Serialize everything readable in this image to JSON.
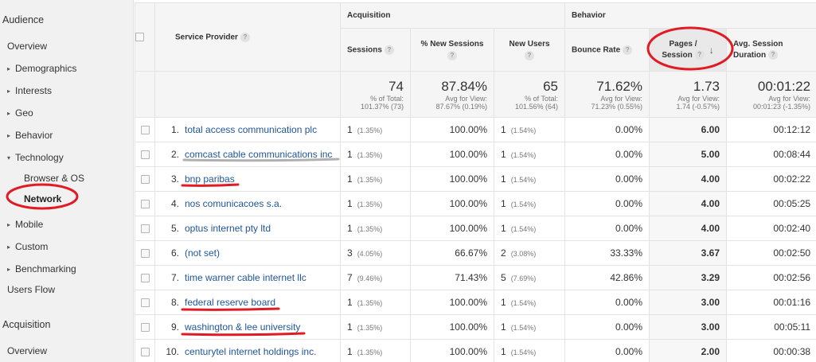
{
  "sidebar": {
    "audience": "Audience",
    "overview": "Overview",
    "demographics": "Demographics",
    "interests": "Interests",
    "geo": "Geo",
    "behavior": "Behavior",
    "technology": "Technology",
    "browser_os": "Browser & OS",
    "network": "Network",
    "mobile": "Mobile",
    "custom": "Custom",
    "benchmarking": "Benchmarking",
    "users_flow": "Users Flow",
    "acquisition": "Acquisition",
    "acq_overview": "Overview"
  },
  "table": {
    "dimension_header": "Service Provider",
    "group_acquisition": "Acquisition",
    "group_behavior": "Behavior",
    "col_sessions": "Sessions",
    "col_new_sessions": "% New Sessions",
    "col_new_users": "New Users",
    "col_bounce": "Bounce Rate",
    "col_pages_1": "Pages /",
    "col_pages_2": "Session",
    "col_duration_1": "Avg. Session",
    "col_duration_2": "Duration",
    "help_glyph": "?",
    "sort_glyph": "↓",
    "summary": {
      "sessions": "74",
      "sessions_sub1": "% of Total:",
      "sessions_sub2": "101.37% (73)",
      "new_sessions": "87.84%",
      "new_sessions_sub1": "Avg for View:",
      "new_sessions_sub2": "87.67% (0.19%)",
      "new_users": "65",
      "new_users_sub1": "% of Total:",
      "new_users_sub2": "101.56% (64)",
      "bounce": "71.62%",
      "bounce_sub1": "Avg for View:",
      "bounce_sub2": "71.23% (0.55%)",
      "pages": "1.73",
      "pages_sub1": "Avg for View:",
      "pages_sub2": "1.74 (-0.57%)",
      "duration": "00:01:22",
      "duration_sub1": "Avg for View:",
      "duration_sub2": "00:01:23 (-1.35%)"
    },
    "rows": [
      {
        "idx": "1.",
        "provider": "total access communication plc",
        "sessions": "1",
        "sessions_pct": "(1.35%)",
        "new_sessions": "100.00%",
        "new_users": "1",
        "new_users_pct": "(1.54%)",
        "bounce": "0.00%",
        "pages": "6.00",
        "duration": "00:12:12"
      },
      {
        "idx": "2.",
        "provider": "comcast cable communications inc",
        "sessions": "1",
        "sessions_pct": "(1.35%)",
        "new_sessions": "100.00%",
        "new_users": "1",
        "new_users_pct": "(1.54%)",
        "bounce": "0.00%",
        "pages": "5.00",
        "duration": "00:08:44"
      },
      {
        "idx": "3.",
        "provider": "bnp paribas",
        "sessions": "1",
        "sessions_pct": "(1.35%)",
        "new_sessions": "100.00%",
        "new_users": "1",
        "new_users_pct": "(1.54%)",
        "bounce": "0.00%",
        "pages": "4.00",
        "duration": "00:02:22"
      },
      {
        "idx": "4.",
        "provider": "nos comunicacoes s.a.",
        "sessions": "1",
        "sessions_pct": "(1.35%)",
        "new_sessions": "100.00%",
        "new_users": "1",
        "new_users_pct": "(1.54%)",
        "bounce": "0.00%",
        "pages": "4.00",
        "duration": "00:05:25"
      },
      {
        "idx": "5.",
        "provider": "optus internet pty ltd",
        "sessions": "1",
        "sessions_pct": "(1.35%)",
        "new_sessions": "100.00%",
        "new_users": "1",
        "new_users_pct": "(1.54%)",
        "bounce": "0.00%",
        "pages": "4.00",
        "duration": "00:02:40"
      },
      {
        "idx": "6.",
        "provider": "(not set)",
        "sessions": "3",
        "sessions_pct": "(4.05%)",
        "new_sessions": "66.67%",
        "new_users": "2",
        "new_users_pct": "(3.08%)",
        "bounce": "33.33%",
        "pages": "3.67",
        "duration": "00:02:50"
      },
      {
        "idx": "7.",
        "provider": "time warner cable internet llc",
        "sessions": "7",
        "sessions_pct": "(9.46%)",
        "new_sessions": "71.43%",
        "new_users": "5",
        "new_users_pct": "(7.69%)",
        "bounce": "42.86%",
        "pages": "3.29",
        "duration": "00:02:56"
      },
      {
        "idx": "8.",
        "provider": "federal reserve board",
        "sessions": "1",
        "sessions_pct": "(1.35%)",
        "new_sessions": "100.00%",
        "new_users": "1",
        "new_users_pct": "(1.54%)",
        "bounce": "0.00%",
        "pages": "3.00",
        "duration": "00:01:16"
      },
      {
        "idx": "9.",
        "provider": "washington & lee university",
        "sessions": "1",
        "sessions_pct": "(1.35%)",
        "new_sessions": "100.00%",
        "new_users": "1",
        "new_users_pct": "(1.54%)",
        "bounce": "0.00%",
        "pages": "3.00",
        "duration": "00:05:11"
      },
      {
        "idx": "10.",
        "provider": "centurytel internet holdings inc.",
        "sessions": "1",
        "sessions_pct": "(1.35%)",
        "new_sessions": "100.00%",
        "new_users": "1",
        "new_users_pct": "(1.54%)",
        "bounce": "0.00%",
        "pages": "2.00",
        "duration": "00:00:38"
      }
    ]
  },
  "colors": {
    "link": "#1f5599",
    "annotation": "#e01b24",
    "underline_gray": "#b0b0b0"
  }
}
